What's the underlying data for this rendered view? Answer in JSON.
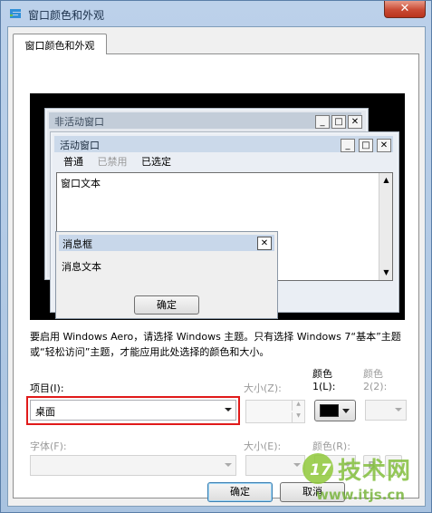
{
  "window": {
    "title": "窗口颜色和外观",
    "close_glyph": "✕"
  },
  "tab": {
    "label": "窗口颜色和外观"
  },
  "preview": {
    "inactive_title": "非活动窗口",
    "active_title": "活动窗口",
    "menu": {
      "normal": "普通",
      "disabled": "已禁用",
      "selected": "已选定"
    },
    "window_text": "窗口文本",
    "msgbox_title": "消息框",
    "msg_text": "消息文本",
    "msg_ok": "确定",
    "ctrl": {
      "minimize": "_",
      "maximize": "□",
      "close": "✕"
    }
  },
  "description": "要启用 Windows Aero，请选择 Windows 主题。只有选择 Windows 7“基本”主题或“轻松访问”主题，才能应用此处选择的颜色和大小。",
  "item": {
    "label": "项目(I):",
    "value": "桌面"
  },
  "size1_label": "大小(Z):",
  "color1_label": "颜色",
  "color1_sub": "1(L):",
  "color2_label": "颜色",
  "color2_sub": "2(2):",
  "font": {
    "label": "字体(F):"
  },
  "size2_label": "大小(E):",
  "color3_label": "颜色(R):",
  "bold_label": "B",
  "italic_label": "I",
  "buttons": {
    "ok": "确定",
    "cancel": "取消"
  },
  "watermark": {
    "brand": "技术网",
    "url": "www.itjs.cn"
  },
  "colors": {
    "accent_red": "#e01a1a",
    "swatch": "#000000"
  }
}
